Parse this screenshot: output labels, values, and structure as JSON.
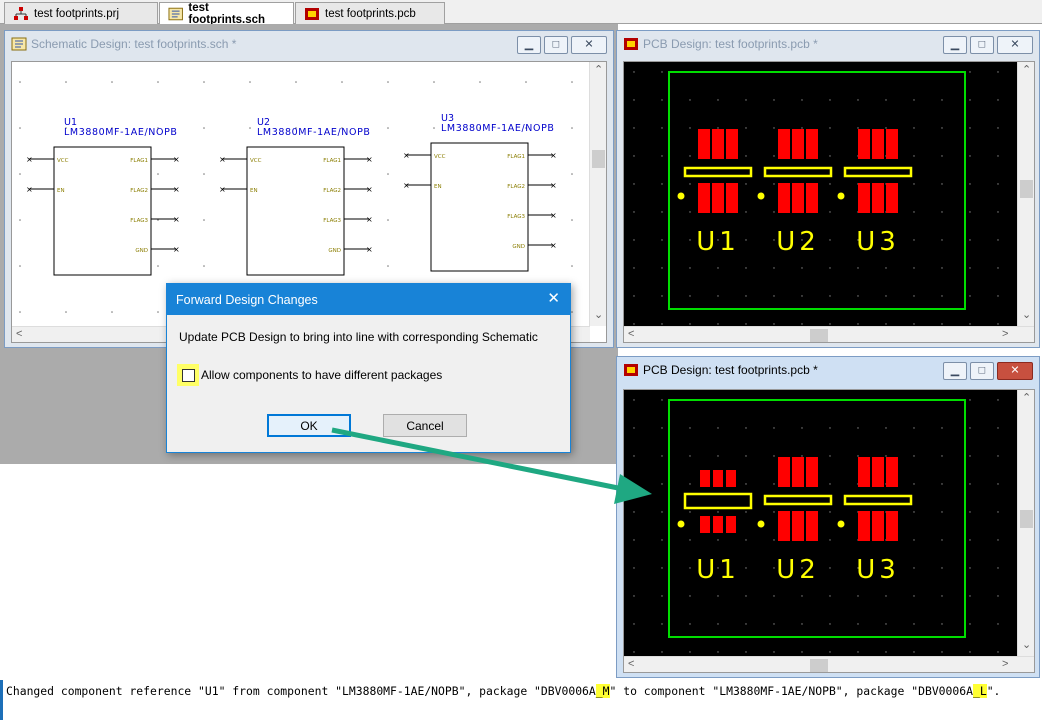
{
  "tabs": [
    {
      "label": "test footprints.prj",
      "icon": "project-icon"
    },
    {
      "label": "test footprints.sch",
      "icon": "schematic-icon"
    },
    {
      "label": "test footprints.pcb",
      "icon": "pcb-icon"
    }
  ],
  "schematic_window": {
    "title": "Schematic Design: test footprints.sch *",
    "components": [
      {
        "ref": "U1",
        "value": "LM3880MF-1AE/NOPB",
        "left_pins": [
          "VCC",
          "EN"
        ],
        "right_pins": [
          "FLAG1",
          "FLAG2",
          "FLAG3",
          "GND"
        ]
      },
      {
        "ref": "U2",
        "value": "LM3880MF-1AE/NOPB",
        "left_pins": [
          "VCC",
          "EN"
        ],
        "right_pins": [
          "FLAG1",
          "FLAG2",
          "FLAG3",
          "GND"
        ]
      },
      {
        "ref": "U3",
        "value": "LM3880MF-1AE/NOPB",
        "left_pins": [
          "VCC",
          "EN"
        ],
        "right_pins": [
          "FLAG1",
          "FLAG2",
          "FLAG3",
          "GND"
        ]
      }
    ]
  },
  "pcb_window_top": {
    "title": "PCB Design: test footprints.pcb *",
    "refs": [
      "U1",
      "U2",
      "U3"
    ]
  },
  "pcb_window_bottom": {
    "title": "PCB Design: test footprints.pcb *",
    "refs": [
      "U1",
      "U2",
      "U3"
    ]
  },
  "dialog": {
    "title": "Forward Design Changes",
    "message": "Update PCB Design to bring into line with corresponding Schematic",
    "checkbox_label": "Allow components to have different packages",
    "checkbox_checked": false,
    "ok_label": "OK",
    "cancel_label": "Cancel"
  },
  "status": {
    "part1": "Changed component reference \"U1\" from component \"LM3880MF-1AE/NOPB\", package \"DBV0006A",
    "hl1": "_M",
    "part2": "\" to component \"LM3880MF-1AE/NOPB\", package \"DBV0006A",
    "hl2": "_L",
    "part3": "\"."
  },
  "colors": {
    "pcb_board": "#000000",
    "pcb_outline": "#00dd00",
    "pad": "#ff0000",
    "silk": "#ffff00",
    "schematic_text": "#0000cc",
    "dialog_titlebar": "#1883d7",
    "arrow": "#1fa882",
    "highlight": "#ffff33"
  }
}
